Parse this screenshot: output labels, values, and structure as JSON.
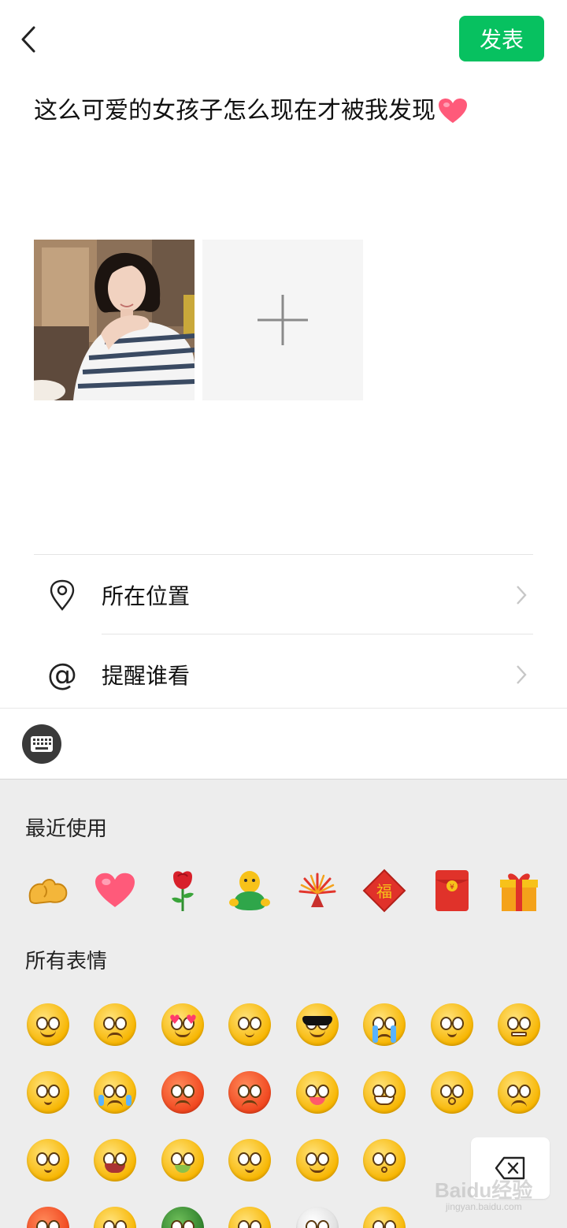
{
  "header": {
    "back_icon": "chevron-left-icon",
    "publish_label": "发表",
    "accent_color": "#07c160"
  },
  "post": {
    "text": "这么可爱的女孩子怎么现在才被我发现",
    "trailing_emoji": "heart"
  },
  "media": {
    "photo_alt": "woman in striped shirt",
    "add_icon": "plus-icon"
  },
  "options": [
    {
      "icon": "location-pin-icon",
      "label": "所在位置"
    },
    {
      "icon": "at-sign-icon",
      "label": "提醒谁看"
    }
  ],
  "keyboard_toggle_icon": "keyboard-icon",
  "emoji_panel": {
    "recent_title": "最近使用",
    "all_title": "所有表情",
    "recent": [
      "strong-arm",
      "heart",
      "rose",
      "green-figure",
      "fireworks",
      "fu-diamond",
      "red-packet",
      "gift"
    ],
    "delete_icon": "backspace-icon"
  },
  "watermark": {
    "brand": "Baidu经验",
    "url": "jingyan.baidu.com"
  }
}
